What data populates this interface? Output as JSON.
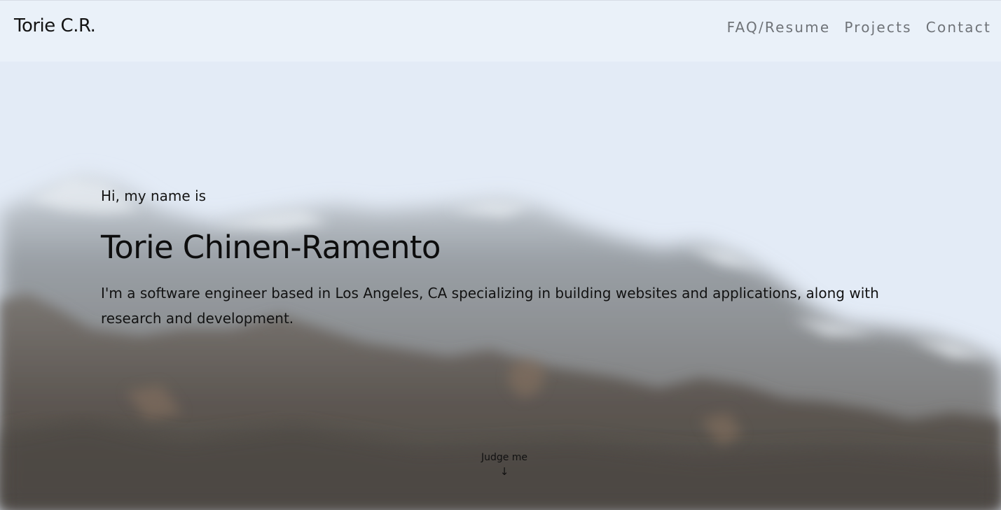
{
  "header": {
    "brand": "Torie C.R.",
    "nav": [
      {
        "label": "FAQ/Resume"
      },
      {
        "label": "Projects"
      },
      {
        "label": "Contact"
      }
    ]
  },
  "hero": {
    "greeting": "Hi, my name is",
    "name": "Torie Chinen-Ramento",
    "description": "I'm a software engineer based in Los Angeles, CA specializing in building websites and applications, along with research and development.",
    "background": "blurred-mountain-landscape"
  },
  "scroll_cue": {
    "label": "Judge me",
    "arrow": "↓"
  },
  "colors": {
    "sky": "#e3ebf6",
    "nav_text": "#6f7378",
    "text": "#111111"
  }
}
